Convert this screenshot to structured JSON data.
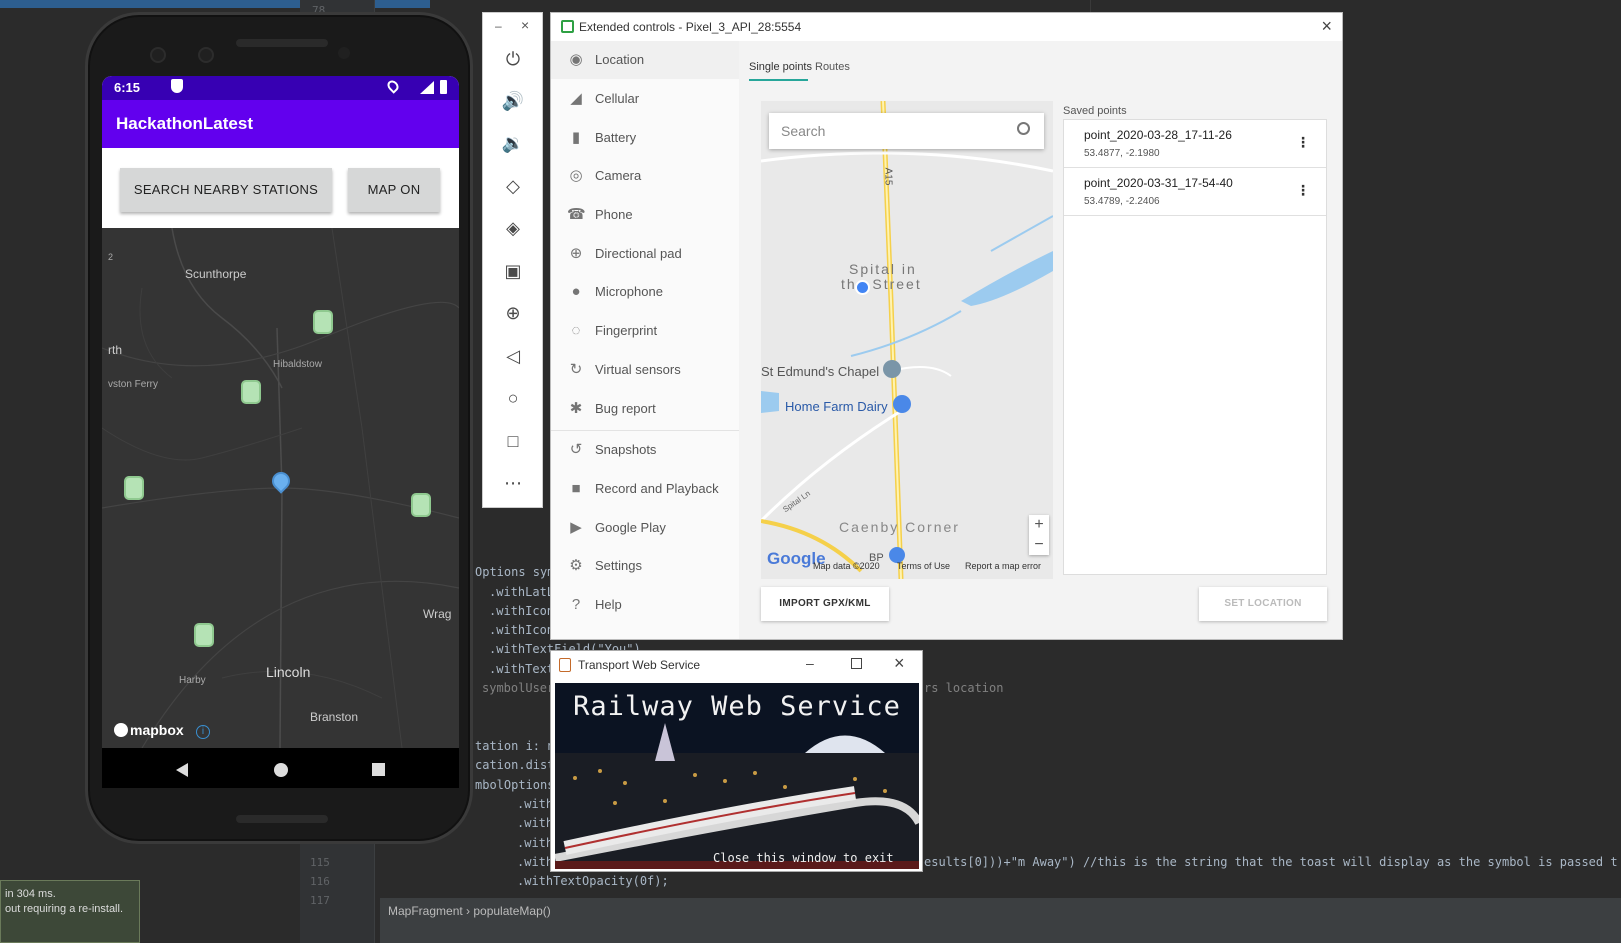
{
  "ide": {
    "line_numbers": [
      "78",
      "115",
      "116",
      "117"
    ],
    "code_fragments": {
      "symbol_options": "Options sym",
      "with_latl": ".withLatL",
      "with_icon1": ".withIcon",
      "with_icon2": ".withIcon",
      "with_text_field": ".withTextField(\"You\")",
      "with_text": ".withText",
      "symbol_user": "symbolUser",
      "location_comment": "rs location",
      "station_loop": "tation i: n",
      "location_dist": "cation.dist",
      "symbol_options2": "mbolOptions",
      "with_a": ".with",
      "with_b": ".with",
      "with_c": ".with",
      "with_d": ".with",
      "results_line": "esults[0]))+\"m Away\") //this is the string that the toast will display as the symbol is passed t",
      "text_opacity": ".withTextOpacity(0f);",
      "breadcrumb": "MapFragment  ›  populateMap()"
    },
    "notification": {
      "line1": "in 304 ms.",
      "line2": "out requiring a re-install."
    }
  },
  "phone": {
    "status_time": "6:15",
    "app_title": "HackathonLatest",
    "buttons": {
      "search": "SEARCH NEARBY STATIONS",
      "map_on": "MAP ON"
    },
    "map_labels": {
      "scunthorpe": "Scunthorpe",
      "hibaldstow": "Hibaldstow",
      "orth": "rth",
      "keadby": "vston Ferry",
      "lincoln": "Lincoln",
      "harby": "Harby",
      "branston": "Branston",
      "wrag": "Wrag",
      "edge2": "2",
      "mapbox": "mapbox"
    }
  },
  "emulator_toolbar": {
    "icons": [
      "power-icon",
      "volume-up-icon",
      "volume-down-icon",
      "rotate-left-icon",
      "rotate-right-icon",
      "camera-icon",
      "zoom-icon",
      "back-icon",
      "home-icon",
      "overview-icon",
      "more-icon"
    ]
  },
  "extended_controls": {
    "title": "Extended controls - Pixel_3_API_28:5554",
    "sidebar": [
      {
        "label": "Location",
        "icon": "location-pin-icon",
        "glyph": "◉"
      },
      {
        "label": "Cellular",
        "icon": "cellular-icon",
        "glyph": "◢"
      },
      {
        "label": "Battery",
        "icon": "battery-icon",
        "glyph": "▮"
      },
      {
        "label": "Camera",
        "icon": "camera-icon",
        "glyph": "◎"
      },
      {
        "label": "Phone",
        "icon": "phone-icon",
        "glyph": "☎"
      },
      {
        "label": "Directional pad",
        "icon": "dpad-icon",
        "glyph": "⊕"
      },
      {
        "label": "Microphone",
        "icon": "microphone-icon",
        "glyph": "●"
      },
      {
        "label": "Fingerprint",
        "icon": "fingerprint-icon",
        "glyph": "◌"
      },
      {
        "label": "Virtual sensors",
        "icon": "virtual-sensors-icon",
        "glyph": "↻"
      },
      {
        "label": "Bug report",
        "icon": "bug-icon",
        "glyph": "✱"
      },
      {
        "label": "Snapshots",
        "icon": "snapshots-icon",
        "glyph": "↺"
      },
      {
        "label": "Record and Playback",
        "icon": "record-icon",
        "glyph": "■"
      },
      {
        "label": "Google Play",
        "icon": "google-play-icon",
        "glyph": "▶"
      },
      {
        "label": "Settings",
        "icon": "settings-icon",
        "glyph": "⚙"
      },
      {
        "label": "Help",
        "icon": "help-icon",
        "glyph": "?"
      }
    ],
    "tabs": {
      "single_points": "Single points",
      "routes": "Routes"
    },
    "map": {
      "search_placeholder": "Search",
      "labels": {
        "spital1": "Spital in",
        "spital2": "the Street",
        "chapel": "St Edmund's Chapel",
        "dairy": "Home Farm Dairy",
        "caenby": "Caenby Corner",
        "road": "A15",
        "lane": "Spital Ln",
        "bp": "BP"
      },
      "google": "Google",
      "map_data": "Map data ©2020",
      "terms": "Terms of Use",
      "report": "Report a map error",
      "zoom_in": "+",
      "zoom_out": "−"
    },
    "saved_points_label": "Saved points",
    "saved_points": [
      {
        "name": "point_2020-03-28_17-11-26",
        "coords": "53.4877, -2.1980"
      },
      {
        "name": "point_2020-03-31_17-54-40",
        "coords": "53.4789, -2.2406"
      }
    ],
    "import_button": "IMPORT GPX/KML",
    "set_location_button": "SET LOCATION"
  },
  "transport_window": {
    "title": "Transport Web Service",
    "heading": "Railway Web Service",
    "footer": "Close this window to exit"
  }
}
